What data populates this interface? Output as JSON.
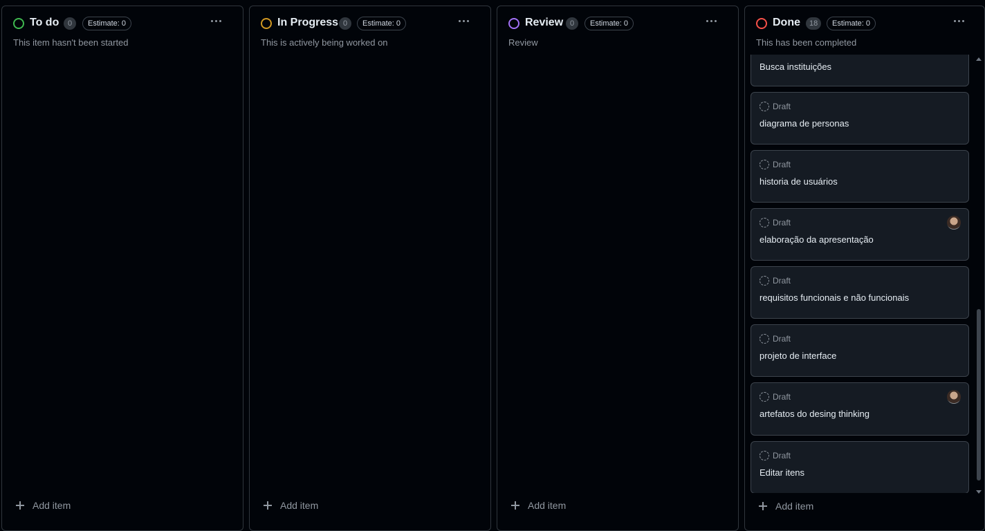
{
  "columns": [
    {
      "title": "To do",
      "count": "0",
      "estimate": "Estimate: 0",
      "description": "This item hasn't been started",
      "status_color": "#3fb950",
      "add_label": "Add item"
    },
    {
      "title": "In Progress",
      "count": "0",
      "estimate": "Estimate: 0",
      "description": "This is actively being worked on",
      "status_color": "#d29922",
      "add_label": "Add item"
    },
    {
      "title": "Review",
      "count": "0",
      "estimate": "Estimate: 0",
      "description": "Review",
      "status_color": "#a371f7",
      "add_label": "Add item"
    },
    {
      "title": "Done",
      "count": "18",
      "estimate": "Estimate: 0",
      "description": "This has been completed",
      "status_color": "#f85149",
      "add_label": "Add item",
      "items": [
        {
          "label": "",
          "title": "Busca instituições"
        },
        {
          "label": "Draft",
          "title": "diagrama de personas"
        },
        {
          "label": "Draft",
          "title": "historia de usuários"
        },
        {
          "label": "Draft",
          "title": "elaboração da apresentação"
        },
        {
          "label": "Draft",
          "title": "requisitos funcionais e não funcionais"
        },
        {
          "label": "Draft",
          "title": "projeto de interface"
        },
        {
          "label": "Draft",
          "title": "artefatos do desing thinking"
        },
        {
          "label": "Draft",
          "title": "Editar itens"
        }
      ]
    }
  ],
  "icons": {
    "status": "circle-icon",
    "more": "kebab-horizontal-icon",
    "draft": "dashed-circle-icon",
    "add": "plus-icon"
  }
}
